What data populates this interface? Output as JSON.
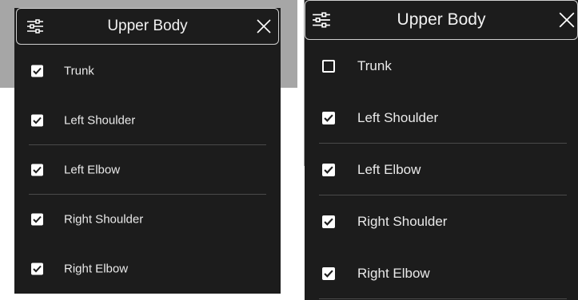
{
  "panels": [
    {
      "title": "Upper Body",
      "items": [
        {
          "label": "Trunk",
          "checked": true
        },
        {
          "label": "Left Shoulder",
          "checked": true
        },
        {
          "label": "Left Elbow",
          "checked": true
        },
        {
          "label": "Right Shoulder",
          "checked": true
        },
        {
          "label": "Right Elbow",
          "checked": true
        }
      ]
    },
    {
      "title": "Upper Body",
      "items": [
        {
          "label": "Trunk",
          "checked": false
        },
        {
          "label": "Left Shoulder",
          "checked": true
        },
        {
          "label": "Left Elbow",
          "checked": true
        },
        {
          "label": "Right Shoulder",
          "checked": true
        },
        {
          "label": "Right Elbow",
          "checked": true
        }
      ]
    }
  ],
  "icons": {
    "settings": "sliders-icon",
    "close": "close-icon",
    "check": "checkmark-icon"
  },
  "colors": {
    "panel": "#1c1c1c",
    "text": "#e9e9e9",
    "divider": "#4a4a4a",
    "backdrop": "#a6a6a6"
  }
}
